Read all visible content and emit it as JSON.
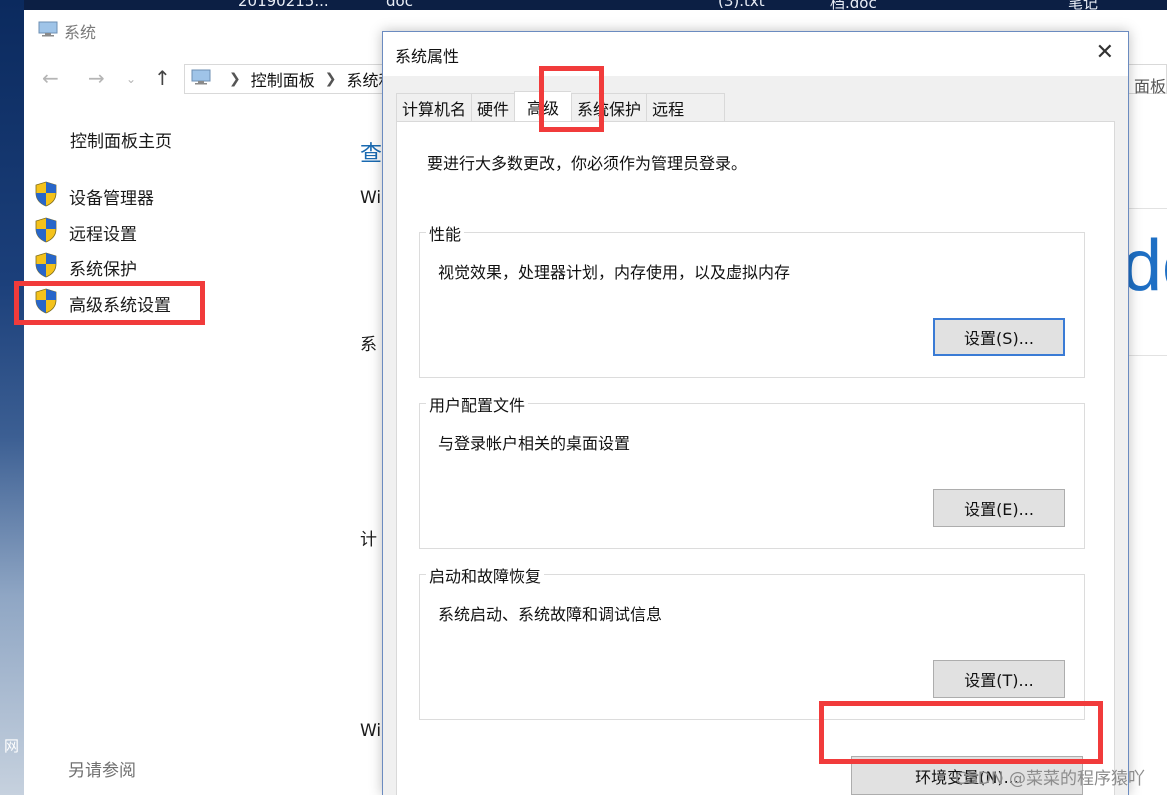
{
  "top_strip": {
    "files": [
      "20190215...",
      "doc",
      "(3).txt",
      "档.doc",
      "笔记"
    ]
  },
  "desktop": {
    "label": "网"
  },
  "system_window": {
    "title": "系统",
    "breadcrumb": [
      "控制面板",
      "系统和"
    ],
    "address_right": "面板",
    "sidebar": {
      "home": "控制面板主页",
      "links": [
        "设备管理器",
        "远程设置",
        "系统保护",
        "高级系统设置"
      ],
      "see_also": "另请参阅"
    },
    "main": {
      "heading": "查",
      "fragments": [
        "Wi",
        "系",
        "计",
        "Wi"
      ],
      "big_text": "do"
    }
  },
  "dialog": {
    "title": "系统属性",
    "tabs": [
      "计算机名",
      "硬件",
      "高级",
      "系统保护",
      "远程"
    ],
    "active_tab": "高级",
    "intro": "要进行大多数更改，你必须作为管理员登录。",
    "groups": [
      {
        "title": "性能",
        "desc": "视觉效果，处理器计划，内存使用，以及虚拟内存",
        "button": "设置(S)..."
      },
      {
        "title": "用户配置文件",
        "desc": "与登录帐户相关的桌面设置",
        "button": "设置(E)..."
      },
      {
        "title": "启动和故障恢复",
        "desc": "系统启动、系统故障和调试信息",
        "button": "设置(T)..."
      }
    ],
    "env_button": "环境变量(N)..."
  },
  "watermark": "CSDN @菜菜的程序猿吖",
  "colors": {
    "highlight": "#f13b3b",
    "link_blue": "#1a6ab1",
    "focus_blue": "#3a7bd5",
    "button_gray": "#e1e1e1"
  }
}
